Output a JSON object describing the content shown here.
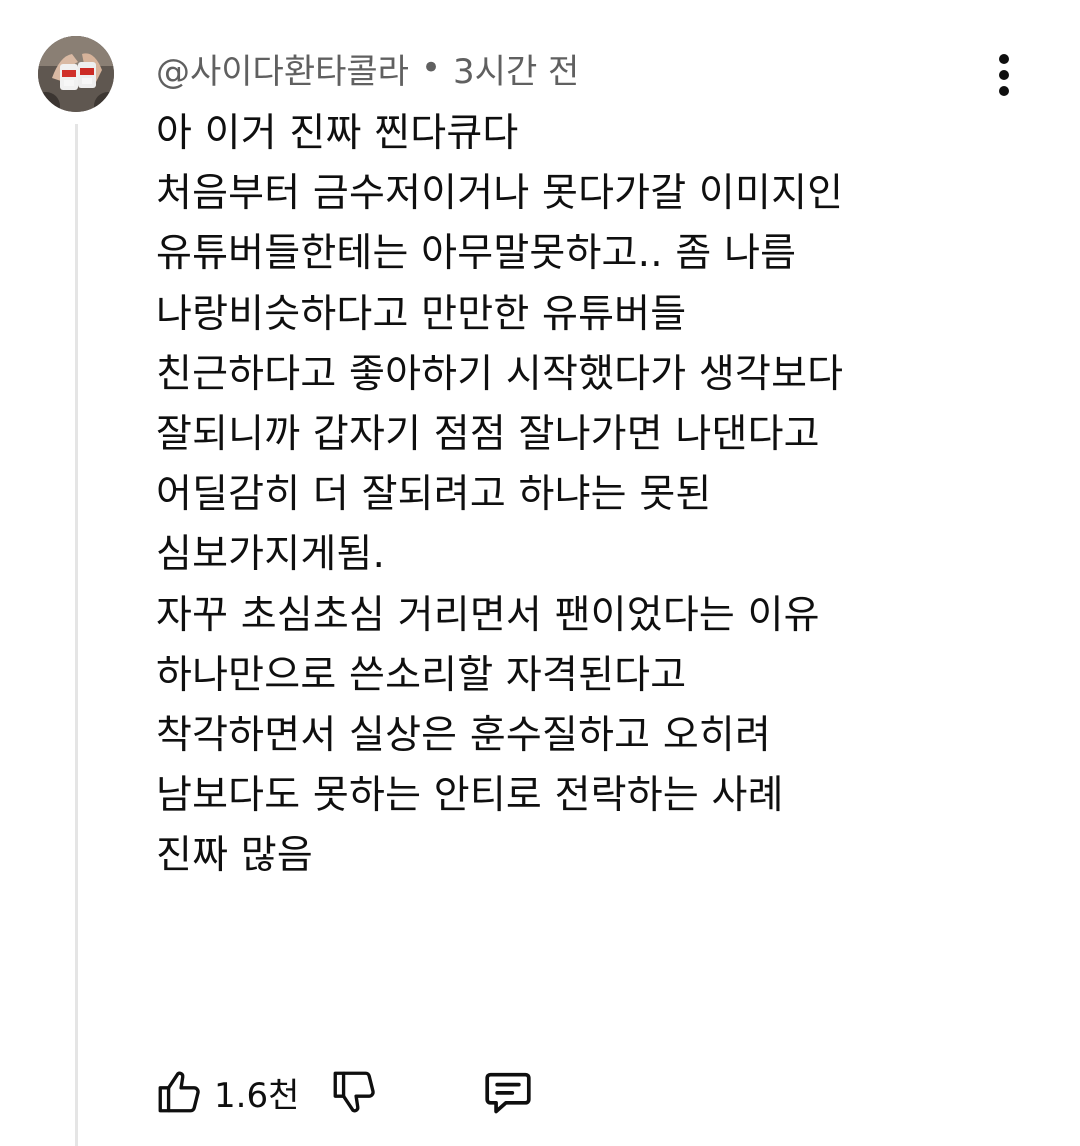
{
  "comment": {
    "author": "@사이다환타콜라",
    "separator": "•",
    "time_ago": "3시간 전",
    "lines": [
      "아 이거 진짜 찐다큐다",
      "처음부터 금수저이거나 못다가갈 이미지인",
      "유튜버들한테는 아무말못하고.. 좀 나름",
      "나랑비슷하다고 만만한 유튜버들",
      "친근하다고 좋아하기 시작했다가 생각보다",
      "잘되니까 갑자기 점점 잘나가면 나댄다고",
      "어딜감히 더 잘되려고 하냐는 못된",
      "심보가지게됨.",
      "자꾸 초심초심 거리면서 팬이었다는 이유",
      "하나만으로 쓴소리할 자격된다고",
      "착각하면서 실상은 훈수질하고 오히려",
      "남보다도 못하는 안티로 전락하는 사례",
      "진짜 많음"
    ],
    "like_count": "1.6천"
  },
  "icons": {
    "more": "vertical-dots-icon",
    "like": "thumbs-up-icon",
    "dislike": "thumbs-down-icon",
    "reply": "comment-bubble-icon"
  },
  "colors": {
    "text": "#0f0f0f",
    "secondary_text": "#606060",
    "thread_line": "#e5e5e5"
  }
}
